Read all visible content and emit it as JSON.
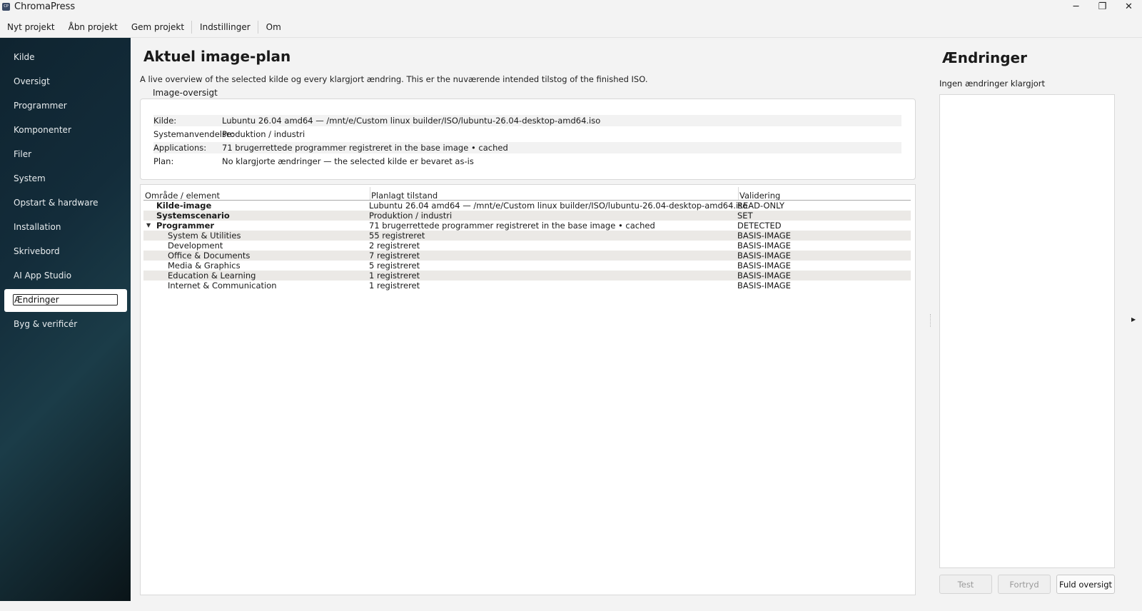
{
  "window": {
    "app_icon_text": "CP",
    "title": "ChromaPress",
    "minimize": "─",
    "maximize": "❐",
    "close": "✕"
  },
  "menu": {
    "items": [
      "Nyt projekt",
      "Åbn projekt",
      "Gem projekt",
      "Indstillinger",
      "Om"
    ]
  },
  "sidebar": {
    "items": [
      {
        "label": "Kilde"
      },
      {
        "label": "Oversigt"
      },
      {
        "label": "Programmer"
      },
      {
        "label": "Komponenter"
      },
      {
        "label": "Filer"
      },
      {
        "label": "System"
      },
      {
        "label": "Opstart & hardware"
      },
      {
        "label": "Installation"
      },
      {
        "label": "Skrivebord"
      },
      {
        "label": "AI App Studio"
      },
      {
        "label": "Ændringer"
      },
      {
        "label": "Byg & verificér"
      }
    ],
    "active_index": 10
  },
  "main": {
    "title": "Aktuel image-plan",
    "description": "A live overview of the selected kilde og every klargjort ændring. This er the nuværende intended tilstog of the finished ISO.",
    "overview_label": "Image-oversigt",
    "overview": [
      {
        "key": "Kilde:",
        "value": "Lubuntu 26.04 amd64 — /mnt/e/Custom linux builder/ISO/lubuntu-26.04-desktop-amd64.iso"
      },
      {
        "key": "Systemanvendelse:",
        "value": "Produktion / industri"
      },
      {
        "key": "Applications:",
        "value": "71 brugerrettede programmer registreret in the base image • cached"
      },
      {
        "key": "Plan:",
        "value": "No klargjorte ændringer — the selected kilde er bevaret as-is"
      }
    ],
    "table": {
      "headers": [
        "Område / element",
        "Planlagt tilstand",
        "Validering"
      ],
      "rows": [
        {
          "element": "Kilde-image",
          "state": "Lubuntu 26.04 amd64 — /mnt/e/Custom linux builder/ISO/lubuntu-26.04-desktop-amd64.iso",
          "validation": "READ-ONLY"
        },
        {
          "element": "Systemscenario",
          "state": "Produktion / industri",
          "validation": "SET"
        },
        {
          "element": "Programmer",
          "state": "71 brugerrettede programmer registreret in the base image • cached",
          "validation": "DETECTED"
        },
        {
          "element": "System & Utilities",
          "state": "55 registreret",
          "validation": "BASIS-IMAGE"
        },
        {
          "element": "Development",
          "state": "2 registreret",
          "validation": "BASIS-IMAGE"
        },
        {
          "element": "Office & Documents",
          "state": "7 registreret",
          "validation": "BASIS-IMAGE"
        },
        {
          "element": "Media & Graphics",
          "state": "5 registreret",
          "validation": "BASIS-IMAGE"
        },
        {
          "element": "Education & Learning",
          "state": "1 registreret",
          "validation": "BASIS-IMAGE"
        },
        {
          "element": "Internet & Communication",
          "state": "1 registreret",
          "validation": "BASIS-IMAGE"
        }
      ]
    }
  },
  "changes": {
    "title": "Ændringer",
    "subtitle": "Ingen ændringer klargjort",
    "buttons": {
      "test": "Test",
      "undo": "Fortryd",
      "full": "Fuld oversigt"
    }
  },
  "colors": {
    "accent_sidebar_dark": "#0f2430",
    "row_shade": "#ebe9e6"
  }
}
